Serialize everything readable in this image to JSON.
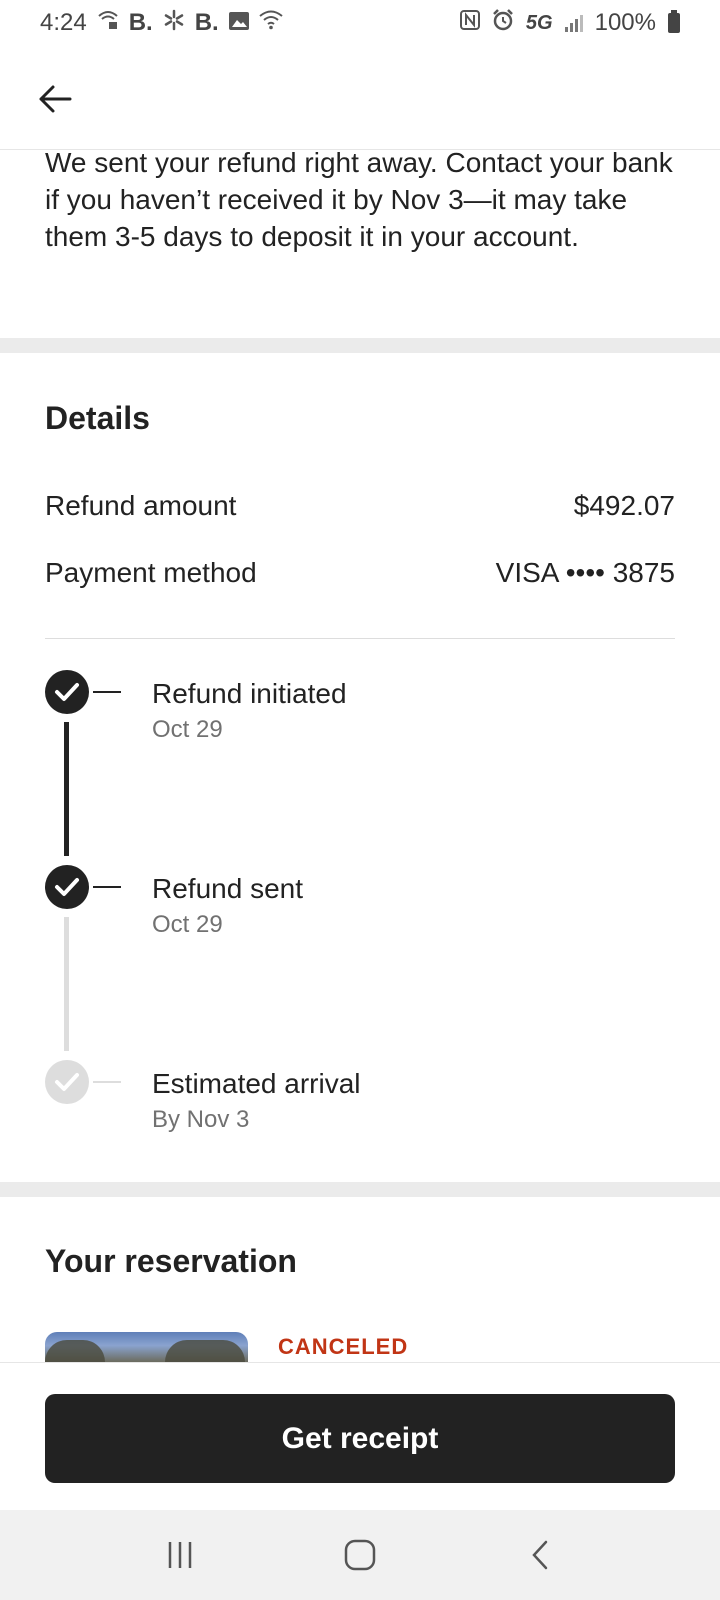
{
  "status_bar": {
    "time": "4:24",
    "left_glyphs": [
      "B.",
      "B."
    ],
    "network": "5G",
    "battery": "100%",
    "icons": [
      "wifi-calling-icon",
      "booking-icon",
      "walmart-spark-icon",
      "booking-icon",
      "gallery-icon",
      "wifi-icon",
      "nfc-icon",
      "alarm-icon",
      "signal-icon",
      "battery-icon"
    ]
  },
  "header": {
    "back_icon": "arrow-left-icon"
  },
  "intro": {
    "text": "We sent your refund right away. Contact your bank if you haven’t received it by Nov 3—it may take them 3-5 days to deposit it in your account."
  },
  "details": {
    "title": "Details",
    "refund_amount_label": "Refund amount",
    "refund_amount_value": "$492.07",
    "payment_method_label": "Payment method",
    "payment_method_value": "VISA •••• 3875"
  },
  "timeline": [
    {
      "label": "Refund initiated",
      "date": "Oct 29",
      "status": "done"
    },
    {
      "label": "Refund sent",
      "date": "Oct 29",
      "status": "done"
    },
    {
      "label": "Estimated arrival",
      "date": "By Nov 3",
      "status": "pending"
    }
  ],
  "reservation": {
    "title": "Your reservation",
    "status": "CANCELED",
    "status_color": "#c13515"
  },
  "footer": {
    "button_label": "Get receipt"
  },
  "nav_bar": {
    "icons": [
      "recents-icon",
      "home-icon",
      "back-icon"
    ]
  },
  "colors": {
    "primary": "#222222",
    "muted": "#717171",
    "divider": "#dddddd",
    "accent_red": "#c13515"
  }
}
